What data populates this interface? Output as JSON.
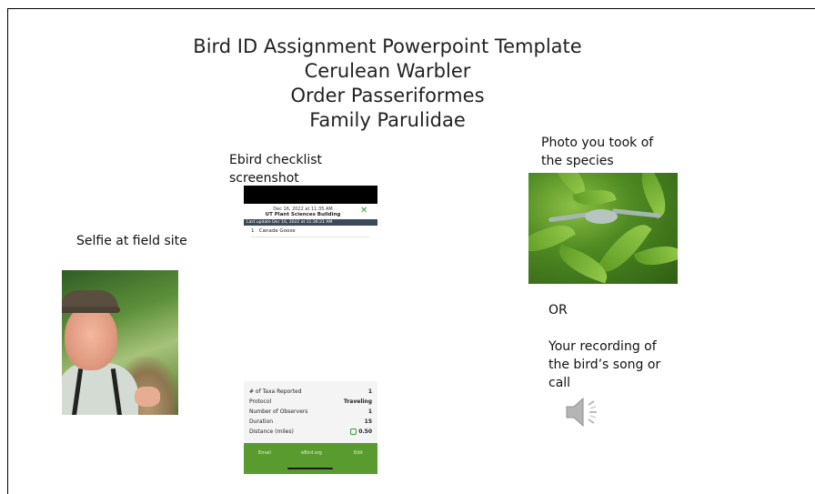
{
  "slide": {
    "title_lines": [
      "Bird ID Assignment Powerpoint Template",
      "Cerulean Warbler",
      "Order Passeriformes",
      "Family Parulidae"
    ],
    "selfie_label": "Selfie at field site",
    "ebird_label": "Ebird checklist screenshot",
    "photo_label": "Photo you took of the species",
    "or_label": "OR",
    "recording_label": "Your recording of the bird’s song or call"
  },
  "ebird_top": {
    "date": "Dec 16, 2022 at 11:35 AM",
    "location": "UT Plant Sciences Building",
    "last_update": "Last update Dec 16, 2022 at 11:36:21 AM",
    "species_count": "1",
    "species_name": "Canada Goose"
  },
  "ebird_bottom": {
    "rows": [
      {
        "label": "# of Taxa Reported",
        "value": "1"
      },
      {
        "label": "Protocol",
        "value": "Traveling"
      },
      {
        "label": "Number of Observers",
        "value": "1"
      },
      {
        "label": "Duration",
        "value": "15"
      },
      {
        "label": "Distance (miles)",
        "value": "0.50"
      }
    ],
    "footer": {
      "email": "Email",
      "site": "eBird.org",
      "edit": "Edit"
    }
  },
  "colors": {
    "ebird_green": "#5a9b2f",
    "accent_green": "#3a9a3a"
  }
}
